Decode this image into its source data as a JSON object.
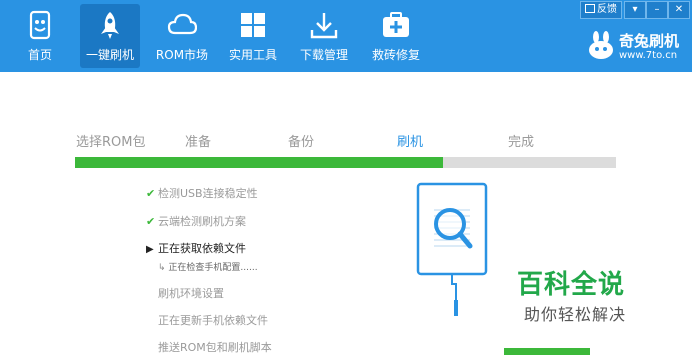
{
  "nav": [
    {
      "label": "首页",
      "icon": "phone-home-icon"
    },
    {
      "label": "一键刷机",
      "icon": "rocket-icon"
    },
    {
      "label": "ROM市场",
      "icon": "cloud-icon"
    },
    {
      "label": "实用工具",
      "icon": "grid-icon"
    },
    {
      "label": "下载管理",
      "icon": "download-icon"
    },
    {
      "label": "救砖修复",
      "icon": "medkit-icon"
    }
  ],
  "window_controls": {
    "feedback": "反馈"
  },
  "brand": {
    "name": "奇兔刷机",
    "url": "www.7to.cn"
  },
  "steps": [
    "选择ROM包",
    "准备",
    "备份",
    "刷机",
    "完成"
  ],
  "active_step": 3,
  "progress": 0.68,
  "tasks": [
    {
      "label": "检测USB连接稳定性",
      "status": "done"
    },
    {
      "label": "云端检测刷机方案",
      "status": "done"
    },
    {
      "label": "正在获取依赖文件",
      "status": "current"
    },
    {
      "label": "刷机环境设置",
      "status": "pending"
    },
    {
      "label": "正在更新手机依赖文件",
      "status": "pending"
    },
    {
      "label": "推送ROM包和刷机脚本",
      "status": "pending"
    }
  ],
  "subtask": "正在检查手机配置......",
  "watermark": {
    "title": "百科全说",
    "subtitle": "助你轻松解决"
  },
  "colors": {
    "header": "#2a93e3",
    "active_nav": "#1b78c4",
    "progress": "#3cb83a",
    "step_active": "#2a93e3"
  }
}
